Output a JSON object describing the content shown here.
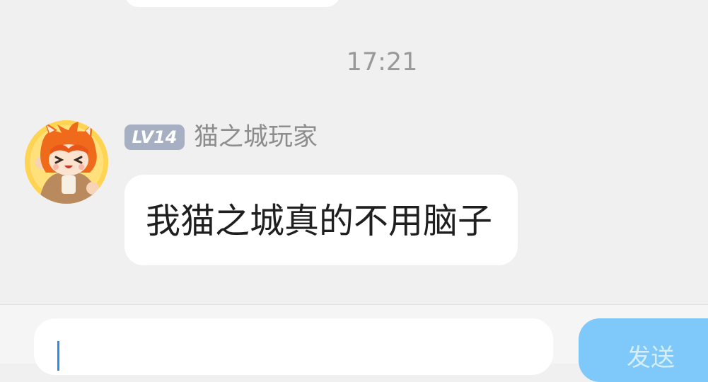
{
  "chat": {
    "timestamp": "17:21",
    "message": {
      "level_badge": "LV14",
      "sender_name": "猫之城玩家",
      "text": "我猫之城真的不用脑子"
    }
  },
  "composer": {
    "input_value": "",
    "send_label": "发送"
  },
  "colors": {
    "background": "#f0f0f0",
    "bubble": "#ffffff",
    "badge": "#a7afc2",
    "send_button": "#7ec9f9",
    "caret": "#2a8cf0"
  }
}
